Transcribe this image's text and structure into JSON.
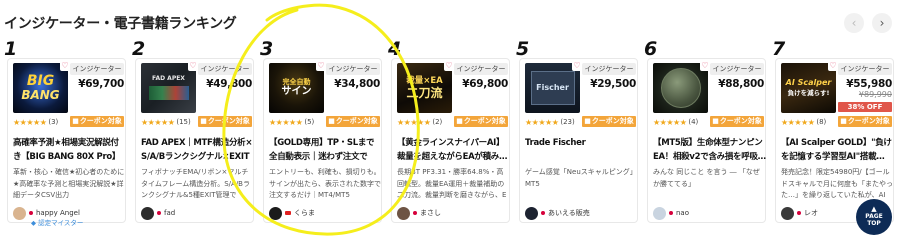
{
  "section": {
    "title": "インジケーター・電子書籍ランキング"
  },
  "nav": {
    "prev_icon": "‹",
    "next_icon": "›"
  },
  "common": {
    "category": "インジケーター",
    "coupon": "クーポン対象",
    "stars": "★★★★★",
    "fav_icon": "♡"
  },
  "cards": [
    {
      "rank": "1",
      "price": "¥69,700",
      "rating_count": "(3)",
      "name": "高確率予測★相場実況解説付き【BIG BANG 80X Pro】トレ",
      "desc": "革新・核心・確信★初心者のために★高確率な予測と相場実況解説★詳細データCSV出力",
      "seller": "happy Angel",
      "seller_sub": "認定マイスター",
      "thumb_line1": "BIG",
      "thumb_line2": "BANG"
    },
    {
      "rank": "2",
      "price": "¥49,800",
      "rating_count": "(15)",
      "name": "FAD APEX｜MTF構造分析×S/A/Bランクシグナル×EXIT",
      "desc": "フィボナッチEMA/リボン×マルチタイムフレーム構造分析。S/A/Bランクシグナル&5種EXIT管理で",
      "seller": "fad",
      "thumb_line1": "FAD APEX",
      "thumb_line2": ""
    },
    {
      "rank": "3",
      "price": "¥34,800",
      "rating_count": "(5)",
      "name": "【GOLD専用】TP・SLまで全自動表示｜迷わず注文でき…",
      "desc": "エントリーも、利確も、損切りも。サインが出たら、表示された数字で注文するだけ｜MT4/MT5",
      "seller": "くらま",
      "thumb_line1": "完全自動",
      "thumb_line2": "サイン"
    },
    {
      "rank": "4",
      "price": "¥69,800",
      "rating_count": "(2)",
      "name": "【黄金ラインスナイパーAI】裁量を超えながらEAが積み…",
      "desc": "長期BT PF3.31・勝率64.8%・高回転型。裁量EA運用＋裁量補助の二刀流。裁量判断を磨きながら、E",
      "seller": "まさし",
      "thumb_line1": "裁量×EA",
      "thumb_line2": "二刀流"
    },
    {
      "rank": "5",
      "price": "¥29,500",
      "rating_count": "(23)",
      "name": "Trade Fischer",
      "desc": "ゲーム感覚「Neuスキャルピング」MT5",
      "seller": "あいえる販売",
      "thumb_line1": "Fischer",
      "thumb_line2": ""
    },
    {
      "rank": "6",
      "price": "¥88,800",
      "rating_count": "(4)",
      "name": "【MT5版】生命体型ナンピンEA！相殺v2で含み損を呼吸…",
      "desc": "みんな 同じこと を言う ― 「なぜか勝ててる」",
      "seller": "nao",
      "thumb_line1": "",
      "thumb_line2": ""
    },
    {
      "rank": "7",
      "price": "¥55,980",
      "price_old": "¥89,990",
      "off": "38% OFF",
      "rating_count": "(8)",
      "name": "【AI Scalper GOLD】\"負けを記憶する学習型AI\"搭載…",
      "desc": "発売記念！限定54980円/【ゴールドスキャルで月に何度も「またやった…」を繰り返していた私が、AI",
      "seller": "レオ",
      "thumb_line1": "AI Scalper",
      "thumb_line2": "負けを減らす!"
    }
  ],
  "page_top": {
    "line1": "PAGE",
    "line2": "TOP",
    "arrow": "▲"
  }
}
